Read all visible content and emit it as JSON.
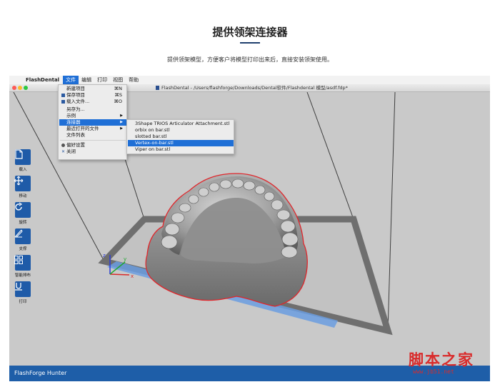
{
  "page": {
    "title": "提供领架连接器",
    "subtitle": "提供领架模型，方便客户将模型打印出来后，直接安装领架使用。"
  },
  "menubar": {
    "apple": "",
    "app_name": "FlashDental",
    "menus": [
      "文件",
      "编辑",
      "打印",
      "视图",
      "帮助"
    ]
  },
  "window": {
    "title": "FlashDental - /Users/flashforge/Downloads/Dental软件/Flashdental 模型/asdf.fdp*"
  },
  "file_menu": {
    "items": [
      {
        "label": "新建项目",
        "shortcut": "⌘N"
      },
      {
        "label": "保存项目",
        "shortcut": "⌘S"
      },
      {
        "label": "载入文件...",
        "shortcut": "⌘O"
      },
      {
        "label": "另存为..."
      },
      {
        "label": "示例",
        "arrow": "▶"
      },
      {
        "label": "连接器",
        "arrow": "▶"
      },
      {
        "label": "最近打开的文件",
        "arrow": "▶"
      },
      {
        "label": "文件列表"
      },
      {
        "label": "偏好设置"
      },
      {
        "label": "关闭",
        "icon_glyph": "✕"
      }
    ]
  },
  "connector_submenu": {
    "items": [
      "3Shape TRIOS Articulator Attachment.stl",
      "orbix on bar.stl",
      "slotted bar.stl",
      "Vertex-on-bar.stl",
      "Viper on bar.stl"
    ],
    "selected": "Vertex-on-bar.stl"
  },
  "toolbar": {
    "tools": [
      {
        "label": "载入",
        "icon": "file-icon"
      },
      {
        "label": "移动",
        "icon": "move-icon"
      },
      {
        "label": "旋转",
        "icon": "rotate-icon"
      },
      {
        "label": "支撑",
        "icon": "support-icon"
      },
      {
        "label": "智能排布",
        "icon": "layout-icon"
      },
      {
        "label": "打印",
        "icon": "print-icon"
      }
    ]
  },
  "axes": {
    "x": "x",
    "y": "y",
    "z": "z"
  },
  "status": {
    "text": "FlashForge Hunter"
  },
  "watermark": {
    "text": "脚本之家",
    "url": "www.jb51.net"
  },
  "colors": {
    "accent": "#1f5ba8",
    "menu_highlight": "#1f6fd6",
    "model_outline": "#e0262b",
    "viewport_bg": "#c9c9c9"
  }
}
